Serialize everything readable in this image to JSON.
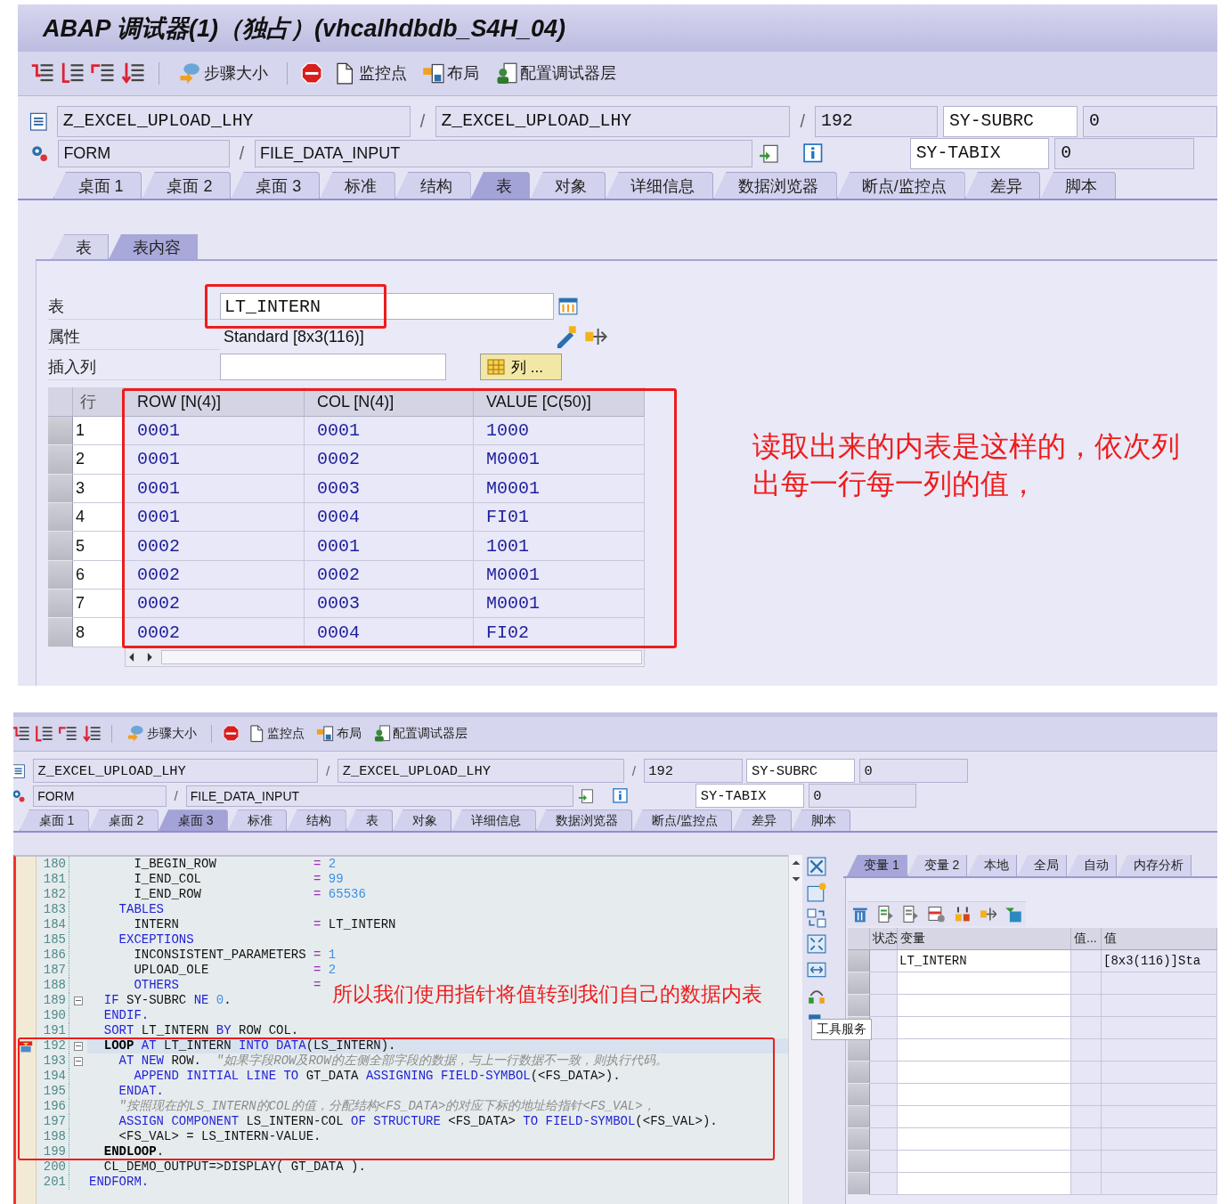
{
  "top": {
    "title": "ABAP 调试器(1)（独占）(vhcalhdbdb_S4H_04)",
    "toolbar": [
      "步骤大小",
      "监控点",
      "布局",
      "配置调试器层"
    ],
    "program": "Z_EXCEL_UPLOAD_LHY",
    "include": "Z_EXCEL_UPLOAD_LHY",
    "line": "192",
    "event_type": "FORM",
    "event": "FILE_DATA_INPUT",
    "separators": [
      "/",
      "/",
      "/"
    ],
    "sys_fields": [
      {
        "name": "SY-SUBRC",
        "value": "0"
      },
      {
        "name": "SY-TABIX",
        "value": "0"
      }
    ],
    "tabs": [
      {
        "label": "桌面 1",
        "selected": false
      },
      {
        "label": "桌面 2",
        "selected": false
      },
      {
        "label": "桌面 3",
        "selected": false
      },
      {
        "label": "标准",
        "selected": false
      },
      {
        "label": "结构",
        "selected": false
      },
      {
        "label": "表",
        "selected": true
      },
      {
        "label": "对象",
        "selected": false
      },
      {
        "label": "详细信息",
        "selected": false
      },
      {
        "label": "数据浏览器",
        "selected": false
      },
      {
        "label": "断点/监控点",
        "selected": false
      },
      {
        "label": "差异",
        "selected": false
      },
      {
        "label": "脚本",
        "selected": false
      }
    ],
    "subtabs": [
      {
        "label": "表",
        "selected": false
      },
      {
        "label": "表内容",
        "selected": true
      }
    ],
    "table_label": "表",
    "table_name": "LT_INTERN",
    "attr_label": "属性",
    "attr": "Standard [8x3(116)]",
    "insert_label": "插入列",
    "column_button": "列 ...",
    "grid": {
      "columns": [
        "行",
        "ROW [N(4)]",
        "COL [N(4)]",
        "VALUE [C(50)]"
      ],
      "rows": [
        [
          "1",
          "0001",
          "0001",
          "1000"
        ],
        [
          "2",
          "0001",
          "0002",
          "M0001"
        ],
        [
          "3",
          "0001",
          "0003",
          "M0001"
        ],
        [
          "4",
          "0001",
          "0004",
          "FI01"
        ],
        [
          "5",
          "0002",
          "0001",
          "1001"
        ],
        [
          "6",
          "0002",
          "0002",
          "M0001"
        ],
        [
          "7",
          "0002",
          "0003",
          "M0001"
        ],
        [
          "8",
          "0002",
          "0004",
          "FI02"
        ]
      ]
    },
    "note": "读取出来的内表是这样的，依次列出每一行每一列的值，"
  },
  "bottom": {
    "toolbar": [
      "步骤大小",
      "监控点",
      "布局",
      "配置调试器层"
    ],
    "program": "Z_EXCEL_UPLOAD_LHY",
    "include": "Z_EXCEL_UPLOAD_LHY",
    "line": "192",
    "event_type": "FORM",
    "event": "FILE_DATA_INPUT",
    "separators": [
      "/",
      "/",
      "/"
    ],
    "sys_fields": [
      {
        "name": "SY-SUBRC",
        "value": "0"
      },
      {
        "name": "SY-TABIX",
        "value": "0"
      }
    ],
    "tabs": [
      {
        "label": "桌面 1",
        "selected": false
      },
      {
        "label": "桌面 2",
        "selected": false
      },
      {
        "label": "桌面 3",
        "selected": true
      },
      {
        "label": "标准",
        "selected": false
      },
      {
        "label": "结构",
        "selected": false
      },
      {
        "label": "表",
        "selected": false
      },
      {
        "label": "对象",
        "selected": false
      },
      {
        "label": "详细信息",
        "selected": false
      },
      {
        "label": "数据浏览器",
        "selected": false
      },
      {
        "label": "断点/监控点",
        "selected": false
      },
      {
        "label": "差异",
        "selected": false
      },
      {
        "label": "脚本",
        "selected": false
      }
    ],
    "code": [
      {
        "no": "180",
        "fold": false,
        "current": false,
        "tokens": [
          {
            "kind": "id",
            "text": "      I_BEGIN_ROW             "
          },
          {
            "kind": "op",
            "text": "="
          },
          {
            "kind": "num",
            "text": " 2"
          }
        ]
      },
      {
        "no": "181",
        "fold": false,
        "current": false,
        "tokens": [
          {
            "kind": "id",
            "text": "      I_END_COL               "
          },
          {
            "kind": "op",
            "text": "="
          },
          {
            "kind": "num",
            "text": " 99"
          }
        ]
      },
      {
        "no": "182",
        "fold": false,
        "current": false,
        "tokens": [
          {
            "kind": "id",
            "text": "      I_END_ROW               "
          },
          {
            "kind": "op",
            "text": "="
          },
          {
            "kind": "num",
            "text": " 65536"
          }
        ]
      },
      {
        "no": "183",
        "fold": false,
        "current": false,
        "tokens": [
          {
            "kind": "kw",
            "text": "    TABLES"
          }
        ]
      },
      {
        "no": "184",
        "fold": false,
        "current": false,
        "tokens": [
          {
            "kind": "id",
            "text": "      INTERN                  "
          },
          {
            "kind": "op",
            "text": "="
          },
          {
            "kind": "id",
            "text": " LT_INTERN"
          }
        ]
      },
      {
        "no": "185",
        "fold": false,
        "current": false,
        "tokens": [
          {
            "kind": "kw",
            "text": "    EXCEPTIONS"
          }
        ]
      },
      {
        "no": "186",
        "fold": false,
        "current": false,
        "tokens": [
          {
            "kind": "id",
            "text": "      INCONSISTENT_PARAMETERS "
          },
          {
            "kind": "op",
            "text": "="
          },
          {
            "kind": "num",
            "text": " 1"
          }
        ]
      },
      {
        "no": "187",
        "fold": false,
        "current": false,
        "tokens": [
          {
            "kind": "id",
            "text": "      UPLOAD_OLE              "
          },
          {
            "kind": "op",
            "text": "="
          },
          {
            "kind": "num",
            "text": " 2"
          }
        ]
      },
      {
        "no": "188",
        "fold": false,
        "current": false,
        "tokens": [
          {
            "kind": "kw",
            "text": "      OTHERS                  "
          },
          {
            "kind": "op",
            "text": "="
          }
        ]
      },
      {
        "no": "189",
        "fold": true,
        "current": false,
        "tokens": [
          {
            "kind": "kw",
            "text": "  IF"
          },
          {
            "kind": "id",
            "text": " SY-SUBRC "
          },
          {
            "kind": "kw",
            "text": "NE"
          },
          {
            "kind": "num",
            "text": " 0"
          },
          {
            "kind": "id",
            "text": "."
          }
        ]
      },
      {
        "no": "190",
        "fold": false,
        "current": false,
        "tokens": [
          {
            "kind": "kw",
            "text": "  ENDIF."
          }
        ]
      },
      {
        "no": "191",
        "fold": false,
        "current": false,
        "tokens": [
          {
            "kind": "kw",
            "text": "  SORT"
          },
          {
            "kind": "id",
            "text": " LT_INTERN "
          },
          {
            "kind": "kw",
            "text": "BY"
          },
          {
            "kind": "id",
            "text": " ROW COL."
          }
        ]
      },
      {
        "no": "192",
        "fold": true,
        "current": true,
        "tokens": [
          {
            "kind": "bold",
            "text": "  LOOP "
          },
          {
            "kind": "kw",
            "text": "AT"
          },
          {
            "kind": "id",
            "text": " LT_INTERN "
          },
          {
            "kind": "kw",
            "text": "INTO DATA"
          },
          {
            "kind": "id",
            "text": "(LS_INTERN)."
          }
        ]
      },
      {
        "no": "193",
        "fold": true,
        "current": false,
        "tokens": [
          {
            "kind": "kw",
            "text": "    AT NEW"
          },
          {
            "kind": "id",
            "text": " ROW.  "
          },
          {
            "kind": "cm",
            "text": "\"如果字段ROW及ROW的左侧全部字段的数据，与上一行数据不一致，则执行代码。"
          }
        ]
      },
      {
        "no": "194",
        "fold": false,
        "current": false,
        "tokens": [
          {
            "kind": "kw",
            "text": "      APPEND INITIAL LINE TO"
          },
          {
            "kind": "id",
            "text": " GT_DATA "
          },
          {
            "kind": "kw",
            "text": "ASSIGNING FIELD-SYMBOL"
          },
          {
            "kind": "id",
            "text": "(<FS_DATA>)."
          }
        ]
      },
      {
        "no": "195",
        "fold": false,
        "current": false,
        "tokens": [
          {
            "kind": "kw",
            "text": "    ENDAT."
          }
        ]
      },
      {
        "no": "196",
        "fold": false,
        "current": false,
        "tokens": [
          {
            "kind": "cm",
            "text": "    \"按照现在的LS_INTERN的COL的值，分配结构<FS_DATA>的对应下标的地址给指针<FS_VAL>，"
          }
        ]
      },
      {
        "no": "197",
        "fold": false,
        "current": false,
        "tokens": [
          {
            "kind": "kw",
            "text": "    ASSIGN COMPONENT"
          },
          {
            "kind": "id",
            "text": " LS_INTERN-COL "
          },
          {
            "kind": "kw",
            "text": "OF STRUCTURE"
          },
          {
            "kind": "id",
            "text": " <FS_DATA> "
          },
          {
            "kind": "kw",
            "text": "TO FIELD-SYMBOL"
          },
          {
            "kind": "id",
            "text": "(<FS_VAL>)."
          }
        ]
      },
      {
        "no": "198",
        "fold": false,
        "current": false,
        "tokens": [
          {
            "kind": "id",
            "text": "    <FS_VAL> = LS_INTERN-VALUE."
          }
        ]
      },
      {
        "no": "199",
        "fold": false,
        "current": false,
        "tokens": [
          {
            "kind": "bold",
            "text": "  ENDLOOP"
          },
          {
            "kind": "id",
            "text": "."
          }
        ]
      },
      {
        "no": "200",
        "fold": false,
        "current": false,
        "tokens": [
          {
            "kind": "id",
            "text": "  CL_DEMO_OUTPUT=>DISPLAY( GT_DATA )."
          }
        ]
      },
      {
        "no": "201",
        "fold": false,
        "current": false,
        "tokens": [
          {
            "kind": "kw",
            "text": "ENDFORM."
          }
        ]
      }
    ],
    "note": "所以我们使用指针将值转到我们自己的数据内表",
    "tooltip": "工具服务",
    "var_tabs": [
      {
        "label": "变量 1",
        "selected": true
      },
      {
        "label": "变量 2",
        "selected": false
      },
      {
        "label": "本地",
        "selected": false
      },
      {
        "label": "全局",
        "selected": false
      },
      {
        "label": "自动",
        "selected": false
      },
      {
        "label": "内存分析",
        "selected": false
      }
    ],
    "var_grid": {
      "columns": [
        "状态",
        "变量",
        "值...",
        "值"
      ],
      "rows": [
        {
          "variable": "LT_INTERN",
          "value": "[8x3(116)]Sta"
        }
      ]
    }
  }
}
